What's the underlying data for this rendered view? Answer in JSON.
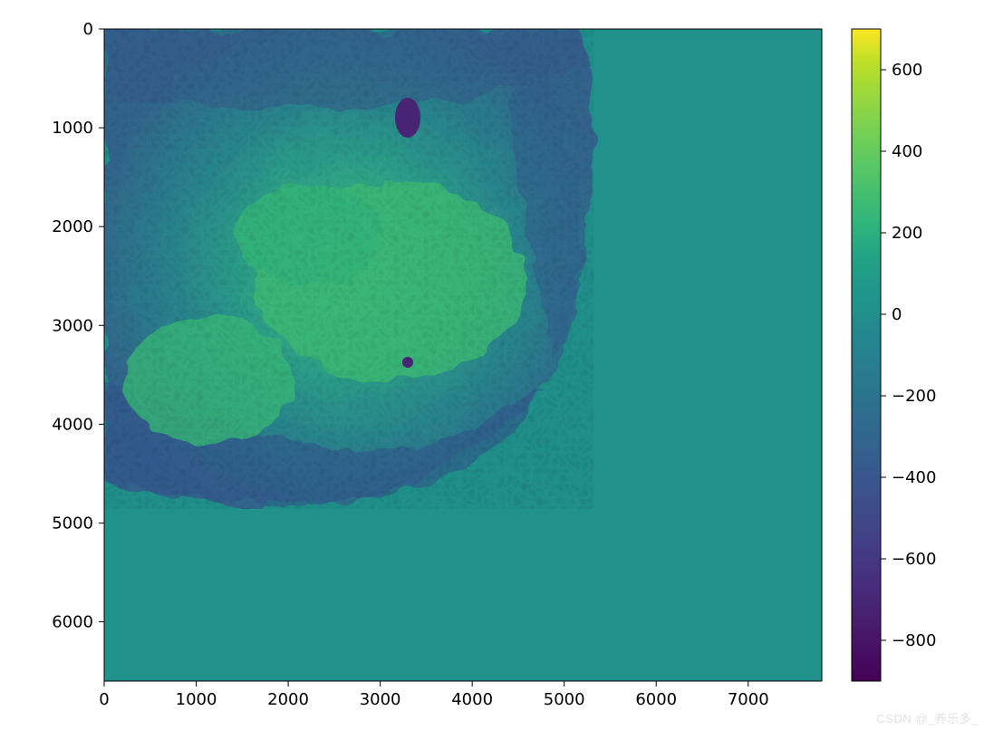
{
  "chart_data": {
    "type": "heatmap",
    "title": "",
    "xlabel": "",
    "ylabel": "",
    "xlim": [
      0,
      7800
    ],
    "ylim": [
      6600,
      0
    ],
    "x_ticks": [
      0,
      1000,
      2000,
      3000,
      4000,
      5000,
      6000,
      7000
    ],
    "y_ticks": [
      0,
      1000,
      2000,
      3000,
      4000,
      5000,
      6000
    ],
    "colorbar": {
      "ticks": [
        -800,
        -600,
        -400,
        -200,
        0,
        200,
        400,
        600
      ],
      "vmin": -900,
      "vmax": 700,
      "cmap": "viridis"
    },
    "background_value": 0,
    "data_region_approx": {
      "x_range": [
        0,
        5000
      ],
      "y_range": [
        0,
        4600
      ],
      "value_range_observed": [
        -900,
        300
      ]
    }
  },
  "watermark": "CSDN @_养乐多_"
}
